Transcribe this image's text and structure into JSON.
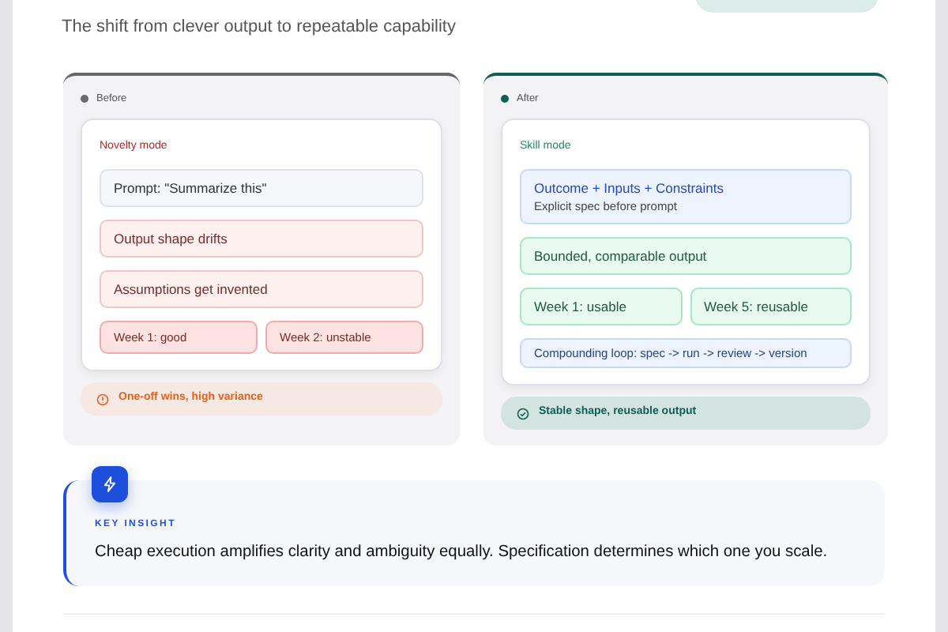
{
  "subtitle": "The shift from clever output to repeatable capability",
  "panels": [
    {
      "kind": "before",
      "label": "Before",
      "mode": "Novelty mode",
      "rows": [
        [
          {
            "kind": "neutral",
            "text": "Prompt: \"Summarize this\""
          }
        ],
        [
          {
            "kind": "warn",
            "text": "Output shape drifts"
          }
        ],
        [
          {
            "kind": "warn",
            "text": "Assumptions get invented"
          }
        ],
        [
          {
            "kind": "alert",
            "text": "Week 1: good"
          },
          {
            "kind": "alert",
            "text": "Week 2: unstable"
          }
        ]
      ],
      "result": "One-off wins, high variance"
    },
    {
      "kind": "after",
      "label": "After",
      "mode": "Skill mode",
      "rows": [
        [
          {
            "kind": "spec",
            "text": "Outcome + Inputs + Constraints",
            "subtext": "Explicit spec before prompt"
          }
        ],
        [
          {
            "kind": "good",
            "text": "Bounded, comparable output"
          }
        ],
        [
          {
            "kind": "good",
            "text": "Week 1: usable"
          },
          {
            "kind": "good",
            "text": "Week 5: reusable"
          }
        ],
        [
          {
            "kind": "loop",
            "text": "Compounding loop: spec -> run -> review -> version"
          }
        ]
      ],
      "result": "Stable shape, reusable output"
    }
  ],
  "insight": {
    "label": "KEY INSIGHT",
    "text": "Cheap execution amplifies clarity and ambiguity equally. Specification determines which one you scale."
  }
}
